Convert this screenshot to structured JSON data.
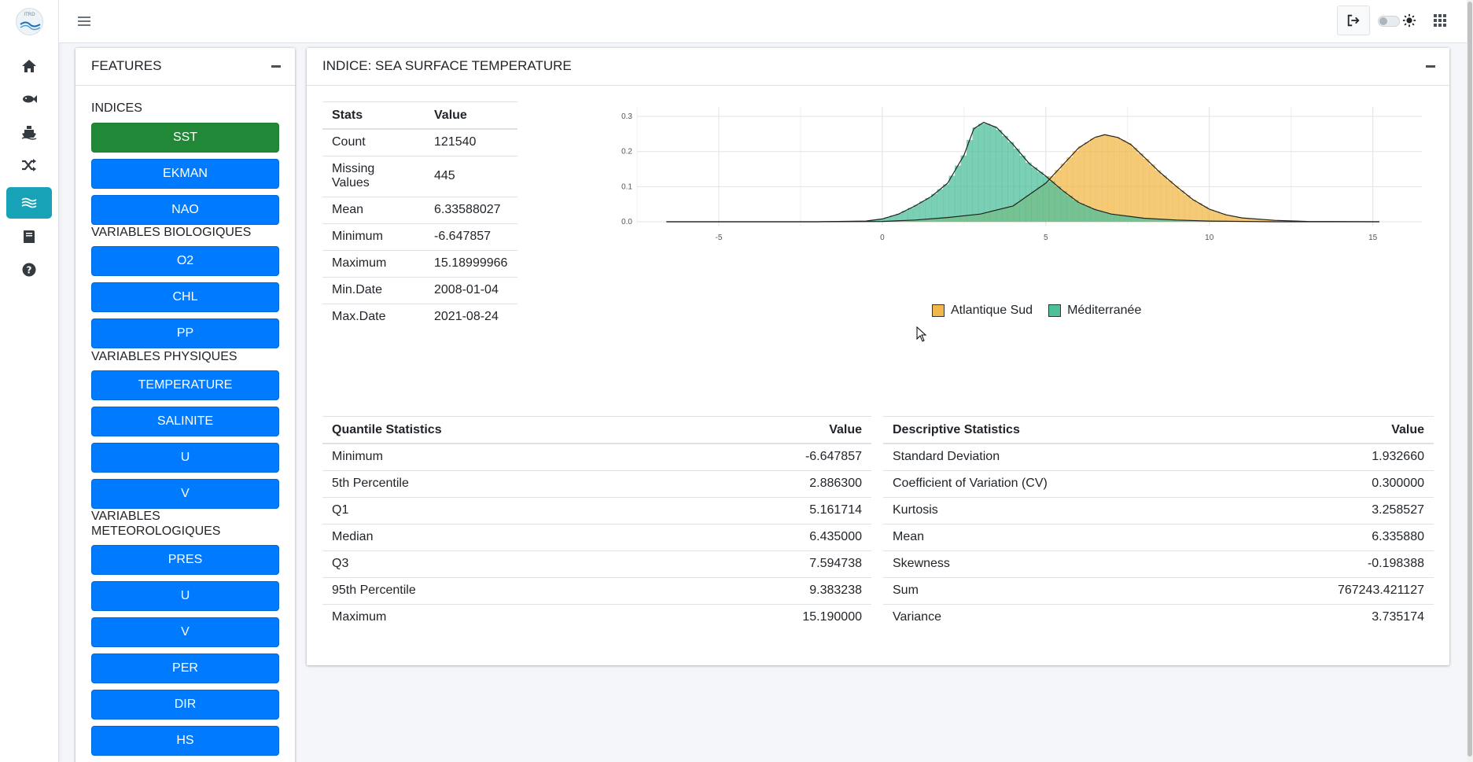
{
  "app": {
    "logo_text": "ITRD"
  },
  "rail": {
    "items": [
      {
        "icon": "home-icon"
      },
      {
        "icon": "fish-icon"
      },
      {
        "icon": "ship-icon"
      },
      {
        "icon": "shuffle-icon"
      },
      {
        "icon": "waves-icon",
        "active": true
      },
      {
        "icon": "book-icon"
      },
      {
        "icon": "help-icon"
      }
    ]
  },
  "features": {
    "title": "FEATURES",
    "groups": [
      {
        "label": "INDICES",
        "buttons": [
          "SST",
          "EKMAN",
          "NAO"
        ]
      },
      {
        "label": "VARIABLES BIOLOGIQUES",
        "buttons": [
          "O2",
          "CHL",
          "PP"
        ]
      },
      {
        "label": "VARIABLES PHYSIQUES",
        "buttons": [
          "TEMPERATURE",
          "SALINITE",
          "U",
          "V"
        ]
      },
      {
        "label": "VARIABLES METEOROLOGIQUES",
        "buttons": [
          "PRES",
          "U",
          "V",
          "PER",
          "DIR",
          "HS"
        ]
      }
    ],
    "active_button": "SST"
  },
  "main": {
    "title": "INDICE: SEA SURFACE TEMPERATURE",
    "stats": {
      "headers": [
        "Stats",
        "Value"
      ],
      "rows": [
        [
          "Count",
          "121540"
        ],
        [
          "Missing Values",
          "445"
        ],
        [
          "Mean",
          "6.33588027"
        ],
        [
          "Minimum",
          "-6.647857"
        ],
        [
          "Maximum",
          "15.18999966"
        ],
        [
          "Min.Date",
          "2008-01-04"
        ],
        [
          "Max.Date",
          "2021-08-24"
        ]
      ]
    },
    "quantile": {
      "headers": [
        "Quantile Statistics",
        "Value"
      ],
      "rows": [
        [
          "Minimum",
          "-6.647857"
        ],
        [
          "5th Percentile",
          "2.886300"
        ],
        [
          "Q1",
          "5.161714"
        ],
        [
          "Median",
          "6.435000"
        ],
        [
          "Q3",
          "7.594738"
        ],
        [
          "95th Percentile",
          "9.383238"
        ],
        [
          "Maximum",
          "15.190000"
        ]
      ]
    },
    "descriptive": {
      "headers": [
        "Descriptive Statistics",
        "Value"
      ],
      "rows": [
        [
          "Standard Deviation",
          "1.932660"
        ],
        [
          "Coefficient of Variation (CV)",
          "0.300000"
        ],
        [
          "Kurtosis",
          "3.258527"
        ],
        [
          "Mean",
          "6.335880"
        ],
        [
          "Skewness",
          "-0.198388"
        ],
        [
          "Sum",
          "767243.421127"
        ],
        [
          "Variance",
          "3.735174"
        ]
      ]
    }
  },
  "chart_data": {
    "type": "area",
    "title": "",
    "xlabel": "",
    "ylabel": "",
    "xlim": [
      -7.5,
      16.5
    ],
    "ylim": [
      0,
      0.3
    ],
    "x_ticks": [
      -5,
      0,
      5,
      10,
      15
    ],
    "y_ticks": [
      0.0,
      0.1,
      0.2,
      0.3
    ],
    "grid": true,
    "legend_position": "bottom",
    "series": [
      {
        "name": "Atlantique Sud",
        "color": "#f0b84a",
        "points": [
          [
            -6.6,
            0.0
          ],
          [
            -2,
            0.0
          ],
          [
            0,
            0.001
          ],
          [
            1,
            0.005
          ],
          [
            2,
            0.012
          ],
          [
            3,
            0.022
          ],
          [
            4,
            0.045
          ],
          [
            5,
            0.11
          ],
          [
            5.5,
            0.16
          ],
          [
            6,
            0.21
          ],
          [
            6.5,
            0.24
          ],
          [
            6.8,
            0.248
          ],
          [
            7.2,
            0.24
          ],
          [
            7.6,
            0.22
          ],
          [
            8,
            0.185
          ],
          [
            8.5,
            0.14
          ],
          [
            9,
            0.1
          ],
          [
            9.5,
            0.063
          ],
          [
            10,
            0.036
          ],
          [
            10.5,
            0.02
          ],
          [
            11,
            0.011
          ],
          [
            12,
            0.004
          ],
          [
            13,
            0.001
          ],
          [
            15.2,
            0.0
          ]
        ]
      },
      {
        "name": "Méditerranée",
        "color": "#4dbf9b",
        "points": [
          [
            -6.6,
            0.0
          ],
          [
            -2,
            0.0
          ],
          [
            -0.5,
            0.002
          ],
          [
            0,
            0.008
          ],
          [
            0.5,
            0.022
          ],
          [
            1,
            0.045
          ],
          [
            1.5,
            0.072
          ],
          [
            2,
            0.11
          ],
          [
            2.5,
            0.19
          ],
          [
            2.8,
            0.265
          ],
          [
            3.1,
            0.283
          ],
          [
            3.5,
            0.268
          ],
          [
            4,
            0.22
          ],
          [
            4.5,
            0.165
          ],
          [
            5,
            0.13
          ],
          [
            5.5,
            0.09
          ],
          [
            6,
            0.055
          ],
          [
            6.5,
            0.035
          ],
          [
            7,
            0.022
          ],
          [
            8,
            0.01
          ],
          [
            9,
            0.005
          ],
          [
            10,
            0.002
          ],
          [
            12,
            0.0
          ],
          [
            15.2,
            0.0
          ]
        ]
      }
    ]
  }
}
